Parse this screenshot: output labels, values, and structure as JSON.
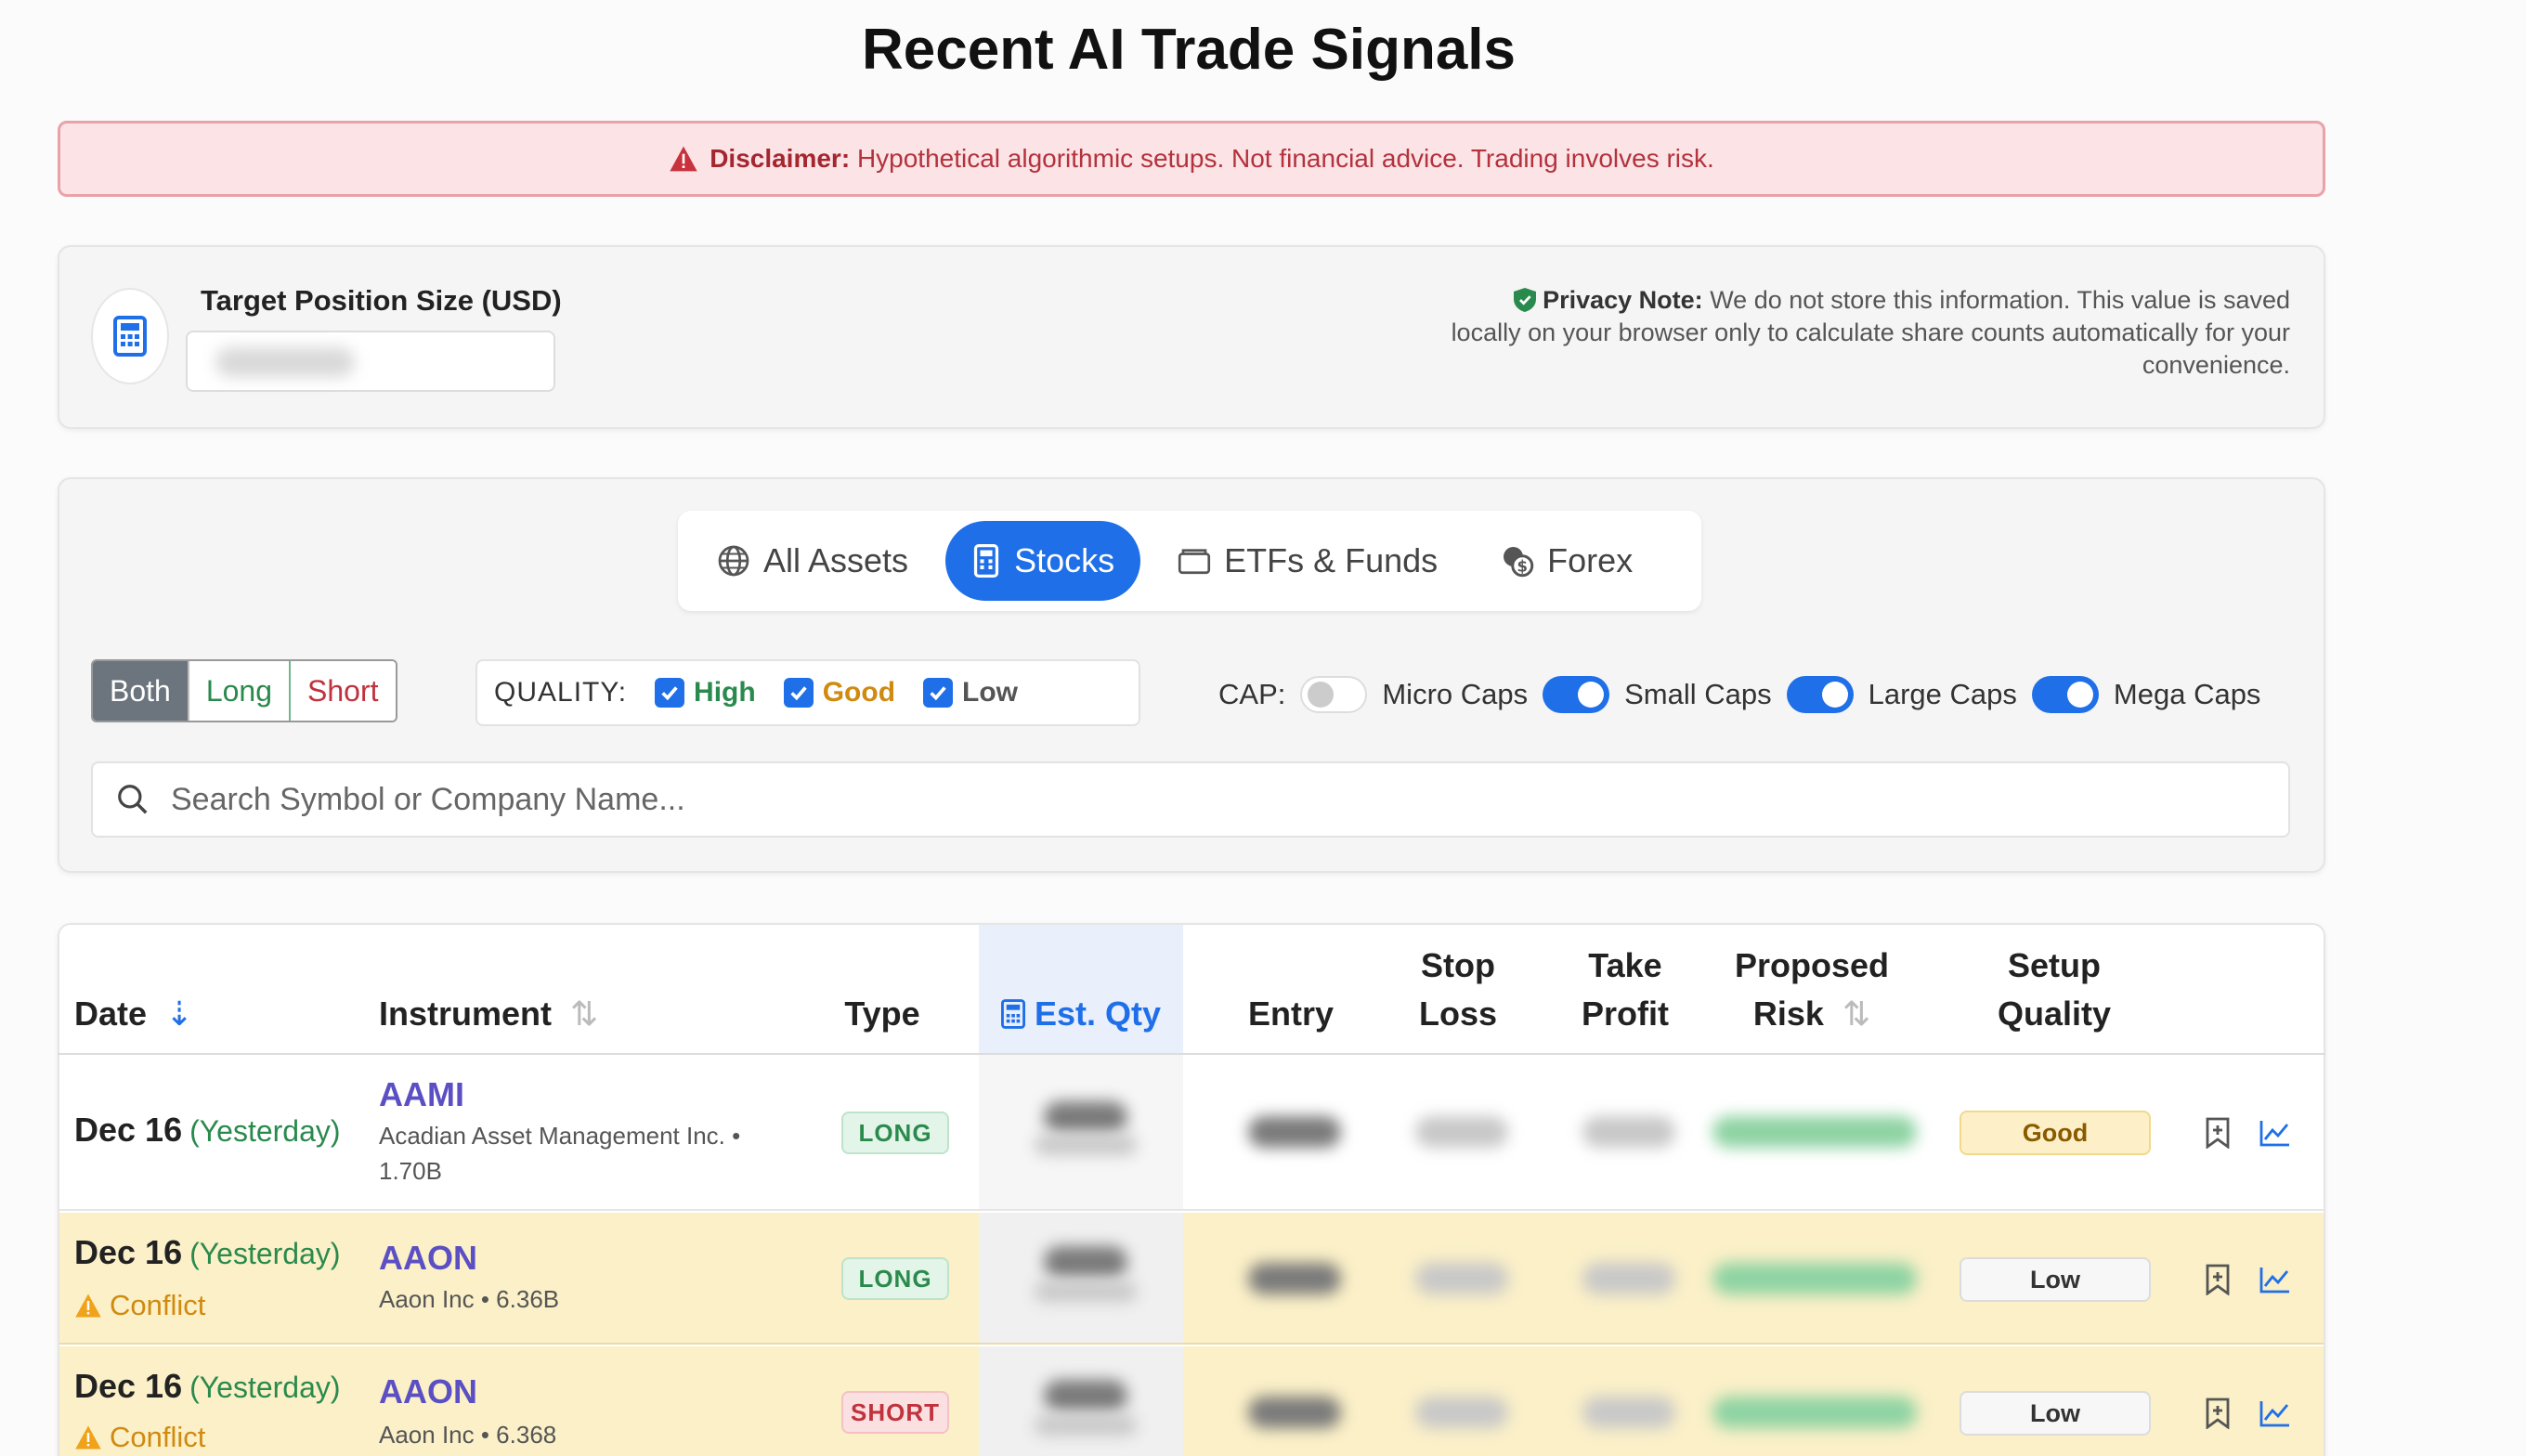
{
  "page": {
    "title": "Recent AI Trade Signals"
  },
  "disclaimer": {
    "label": "Disclaimer:",
    "text": "Hypothetical algorithmic setups. Not financial advice. Trading involves risk."
  },
  "position": {
    "label": "Target Position Size (USD)",
    "privacy_label": "Privacy Note:",
    "privacy_text": "We do not store this information. This value is saved locally on your browser only to calculate share counts automatically for your convenience."
  },
  "tabs": [
    {
      "label": "All Assets",
      "icon": "globe-icon",
      "active": false
    },
    {
      "label": "Stocks",
      "icon": "building-icon",
      "active": true
    },
    {
      "label": "ETFs & Funds",
      "icon": "folder-icon",
      "active": false
    },
    {
      "label": "Forex",
      "icon": "coins-icon",
      "active": false
    }
  ],
  "direction": {
    "both": "Both",
    "long": "Long",
    "short": "Short",
    "selected": "Both"
  },
  "quality": {
    "label": "QUALITY:",
    "high": "High",
    "good": "Good",
    "low": "Low",
    "checked": {
      "high": true,
      "good": true,
      "low": true
    }
  },
  "cap": {
    "label": "CAP:",
    "micro": "Micro Caps",
    "small": "Small Caps",
    "large": "Large Caps",
    "mega": "Mega Caps",
    "enabled": {
      "micro": false,
      "small": true,
      "large": true,
      "mega": true
    }
  },
  "search": {
    "placeholder": "Search Symbol or Company Name..."
  },
  "table": {
    "headers": {
      "date": "Date",
      "instrument": "Instrument",
      "type": "Type",
      "qty": "Est. Qty",
      "entry": "Entry",
      "stop_1": "Stop",
      "stop_2": "Loss",
      "take_1": "Take",
      "take_2": "Profit",
      "risk_1": "Proposed",
      "risk_2": "Risk",
      "setup_1": "Setup",
      "setup_2": "Quality"
    },
    "rows": [
      {
        "date": "Dec 16",
        "rel": "(Yesterday)",
        "conflict": "",
        "symbol": "AAMI",
        "company": "Acadian Asset Management Inc. • 1.70B",
        "type": "LONG",
        "quality": "Good"
      },
      {
        "date": "Dec 16",
        "rel": "(Yesterday)",
        "conflict": "Conflict",
        "symbol": "AAON",
        "company": "Aaon Inc • 6.36B",
        "type": "LONG",
        "quality": "Low"
      },
      {
        "date": "Dec 16",
        "rel": "(Yesterday)",
        "conflict": "Conflict",
        "symbol": "AAON",
        "company": "Aaon Inc • 6.368",
        "type": "SHORT",
        "quality": "Low"
      }
    ]
  },
  "colors": {
    "accent": "#1f6fe8",
    "long": "#2a8a4d",
    "short": "#c0323c",
    "warning": "#d08a10",
    "conflict_row": "#fbf0c8"
  }
}
